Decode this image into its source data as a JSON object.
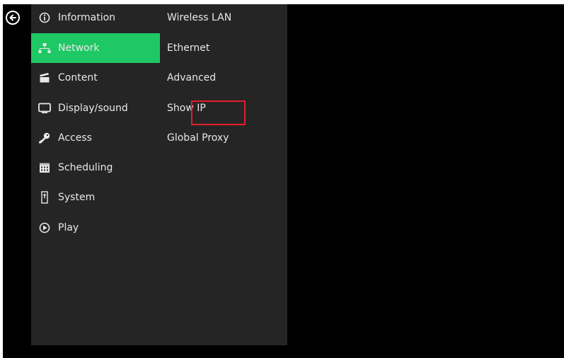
{
  "colors": {
    "screen_bg": "#000000",
    "panel_bg": "#252525",
    "active_bg": "#1ec864",
    "text": "#e8e8e8",
    "highlight_border": "#e41e2c"
  },
  "back": {
    "icon": "back-arrow-circle-icon"
  },
  "menu": [
    {
      "label": "Information",
      "icon": "info-circle-icon"
    },
    {
      "label": "Network",
      "icon": "network-icon",
      "active": true
    },
    {
      "label": "Content",
      "icon": "clapperboard-icon"
    },
    {
      "label": "Display/sound",
      "icon": "monitor-icon"
    },
    {
      "label": "Access",
      "icon": "key-icon"
    },
    {
      "label": "Scheduling",
      "icon": "calendar-icon"
    },
    {
      "label": "System",
      "icon": "system-icon"
    },
    {
      "label": "Play",
      "icon": "play-circle-icon"
    }
  ],
  "submenu": [
    {
      "label": "Wireless LAN"
    },
    {
      "label": "Ethernet"
    },
    {
      "label": "Advanced"
    },
    {
      "label": "Show IP",
      "highlighted": true
    },
    {
      "label": "Global Proxy"
    }
  ]
}
